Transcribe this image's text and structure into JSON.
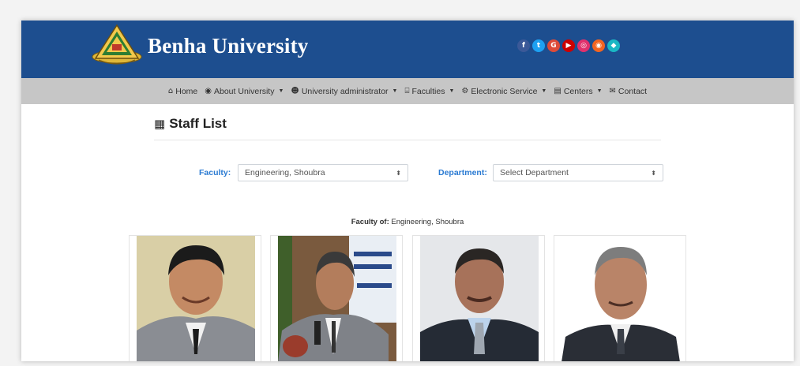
{
  "header": {
    "brand": "Benha University",
    "social": [
      {
        "icon": "facebook-icon",
        "glyph": "f",
        "color": "#3b5998"
      },
      {
        "icon": "twitter-icon",
        "glyph": "t",
        "color": "#1da1f2"
      },
      {
        "icon": "google-icon",
        "glyph": "G",
        "color": "#dd4b39"
      },
      {
        "icon": "youtube-icon",
        "glyph": "▶",
        "color": "#cc0000"
      },
      {
        "icon": "instagram-icon",
        "glyph": "◎",
        "color": "#e1306c"
      },
      {
        "icon": "rss-icon",
        "glyph": "◉",
        "color": "#f26522"
      },
      {
        "icon": "other-social-icon",
        "glyph": "◆",
        "color": "#1ab7c4"
      }
    ]
  },
  "nav": {
    "items": [
      {
        "label": "Home",
        "icon": "home-icon",
        "glyph": "⌂",
        "dropdown": false
      },
      {
        "label": "About University",
        "icon": "eye-icon",
        "glyph": "◉",
        "dropdown": true
      },
      {
        "label": "University administrator",
        "icon": "users-icon",
        "glyph": "☻",
        "dropdown": true
      },
      {
        "label": "Faculties",
        "icon": "institution-icon",
        "glyph": "⌸",
        "dropdown": true
      },
      {
        "label": "Electronic Service",
        "icon": "cogs-icon",
        "glyph": "⚙",
        "dropdown": true
      },
      {
        "label": "Centers",
        "icon": "building-icon",
        "glyph": "▤",
        "dropdown": true
      },
      {
        "label": "Contact",
        "icon": "envelope-icon",
        "glyph": "✉",
        "dropdown": false
      }
    ]
  },
  "page": {
    "title": "Staff List",
    "title_icon": "clipboard-icon"
  },
  "filters": {
    "faculty_label": "Faculty:",
    "faculty_value": "Engineering, Shoubra",
    "department_label": "Department:",
    "department_value": "Select Department"
  },
  "faculty_of": {
    "prefix": "Faculty of:",
    "value": "Engineering, Shoubra"
  },
  "colors": {
    "header_bg": "#1d4e8f",
    "nav_bg": "#c6c6c6",
    "label_blue": "#2a7ad2"
  }
}
